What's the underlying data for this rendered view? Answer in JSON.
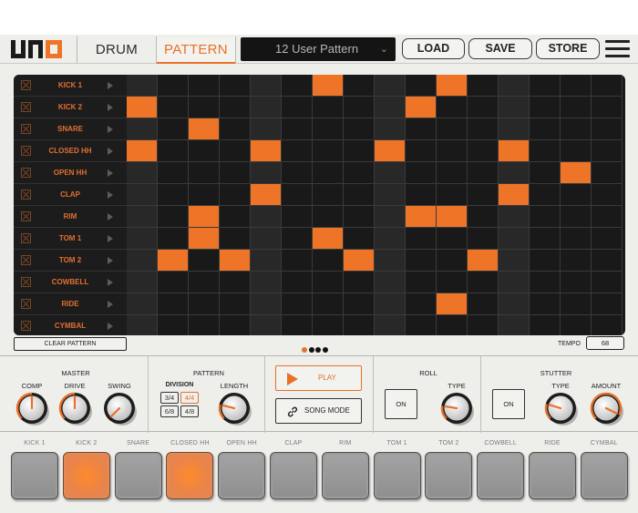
{
  "header": {
    "logo": "uno-logo",
    "tabs": [
      {
        "label": "DRUM",
        "active": false
      },
      {
        "label": "PATTERN",
        "active": true
      }
    ],
    "preset": {
      "value": "12 User Pattern",
      "icon": "chevron-down-icon"
    },
    "buttons": [
      "LOAD",
      "SAVE",
      "STORE"
    ],
    "menu_icon": "hamburger-menu-icon"
  },
  "colors": {
    "accent": "#ee7528",
    "grid_bg": "#191919",
    "grid_beat": "#282828",
    "panel_bg": "#eeeeeb"
  },
  "sequencer": {
    "steps": 16,
    "beat_columns": [
      0,
      4,
      8,
      12
    ],
    "rows": [
      {
        "name": "KICK 1",
        "active_steps": [
          6,
          10
        ]
      },
      {
        "name": "KICK 2",
        "active_steps": [
          0,
          9
        ]
      },
      {
        "name": "SNARE",
        "active_steps": [
          2
        ]
      },
      {
        "name": "CLOSED HH",
        "active_steps": [
          0,
          4,
          8,
          12
        ]
      },
      {
        "name": "OPEN HH",
        "active_steps": [
          14
        ]
      },
      {
        "name": "CLAP",
        "active_steps": [
          4,
          12
        ]
      },
      {
        "name": "RIM",
        "active_steps": [
          2,
          9,
          10
        ]
      },
      {
        "name": "TOM 1",
        "active_steps": [
          2,
          6
        ]
      },
      {
        "name": "TOM 2",
        "active_steps": [
          1,
          3,
          7,
          11
        ]
      },
      {
        "name": "COWBELL",
        "active_steps": []
      },
      {
        "name": "RIDE",
        "active_steps": [
          10
        ]
      },
      {
        "name": "CYMBAL",
        "active_steps": []
      }
    ],
    "clear_label": "CLEAR PATTERN",
    "pages": {
      "count": 4,
      "active": 0
    },
    "tempo": {
      "label": "TEMPO",
      "value": "68"
    }
  },
  "controls": {
    "master": {
      "title": "MASTER",
      "knobs": [
        {
          "label": "COMP",
          "value": 0.5
        },
        {
          "label": "DRIVE",
          "value": 0.5
        },
        {
          "label": "SWING",
          "value": 0.0
        }
      ]
    },
    "pattern": {
      "title": "PATTERN",
      "division_label": "DIVISION",
      "divisions": [
        {
          "label": "3/4",
          "active": false
        },
        {
          "label": "4/4",
          "active": true
        },
        {
          "label": "6/8",
          "active": false
        },
        {
          "label": "4/8",
          "active": false
        }
      ],
      "length": {
        "label": "LENGTH",
        "value": 0.22
      }
    },
    "transport": {
      "play_label": "PLAY",
      "song_mode_label": "SONG MODE"
    },
    "roll": {
      "title": "ROLL",
      "on_label": "ON",
      "type": {
        "label": "TYPE",
        "value": 0.2
      }
    },
    "stutter": {
      "title": "STUTTER",
      "on_label": "ON",
      "type": {
        "label": "TYPE",
        "value": 0.23
      },
      "amount": {
        "label": "AMOUNT",
        "value": 0.93
      }
    }
  },
  "pads": [
    {
      "label": "KICK 1",
      "lit": false
    },
    {
      "label": "KICK 2",
      "lit": true
    },
    {
      "label": "SNARE",
      "lit": false
    },
    {
      "label": "CLOSED HH",
      "lit": true
    },
    {
      "label": "OPEN HH",
      "lit": false
    },
    {
      "label": "CLAP",
      "lit": false
    },
    {
      "label": "RIM",
      "lit": false
    },
    {
      "label": "TOM 1",
      "lit": false
    },
    {
      "label": "TOM 2",
      "lit": false
    },
    {
      "label": "COWBELL",
      "lit": false
    },
    {
      "label": "RIDE",
      "lit": false
    },
    {
      "label": "CYMBAL",
      "lit": false
    }
  ]
}
